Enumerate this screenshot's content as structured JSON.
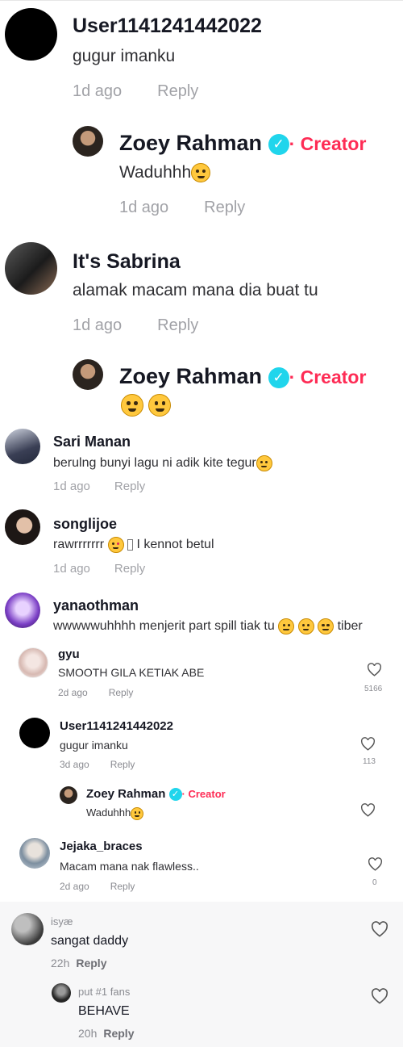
{
  "c1": {
    "user": "User1141241442022",
    "text": "gugur imanku",
    "time": "1d ago",
    "reply": "Reply"
  },
  "c1r": {
    "user": "Zoey Rahman",
    "badge": "Creator",
    "text": "Waduhhh",
    "time": "1d ago",
    "reply": "Reply"
  },
  "c2": {
    "user": "It's Sabrina",
    "text": "alamak macam mana dia buat tu",
    "time": "1d ago",
    "reply": "Reply"
  },
  "c2r": {
    "user": "Zoey Rahman",
    "badge": "Creator"
  },
  "c3": {
    "user": "Sari Manan",
    "text": "berulng bunyi lagu ni adik kite tegur",
    "time": "1d ago",
    "reply": "Reply"
  },
  "c4": {
    "user": "songlijoe",
    "text_a": "rawrrrrrrr",
    "text_b": "I kennot betul",
    "time": "1d ago",
    "reply": "Reply"
  },
  "c5": {
    "user": "yanaothman",
    "text": "wwwwwuhhhh menjerit part spill tiak tu",
    "text_tail": "tiber"
  },
  "c6": {
    "user": "gyu",
    "text": "SMOOTH GILA KETIAK ABE",
    "time": "2d ago",
    "reply": "Reply",
    "likes": "5166"
  },
  "c7": {
    "user": "User1141241442022",
    "text": "gugur imanku",
    "time": "3d ago",
    "reply": "Reply",
    "likes": "113"
  },
  "c7r": {
    "user": "Zoey Rahman",
    "badge": "Creator",
    "text": "Waduhhh"
  },
  "c8": {
    "user": "Jejaka_braces",
    "text": "Macam mana nak flawless..",
    "time": "2d ago",
    "reply": "Reply",
    "likes": "0"
  },
  "c9": {
    "user": "isyæ",
    "text": "sangat daddy",
    "time": "22h",
    "reply": "Reply"
  },
  "c9r": {
    "user": "put #1 fans",
    "text": "BEHAVE",
    "time": "20h",
    "reply": "Reply"
  },
  "icons": {
    "verified": "verified-check-icon",
    "like": "heart-outline-icon"
  },
  "colors": {
    "creator": "#fe2c55",
    "verified": "#20d5ec",
    "muted": "#a1a2a7"
  }
}
